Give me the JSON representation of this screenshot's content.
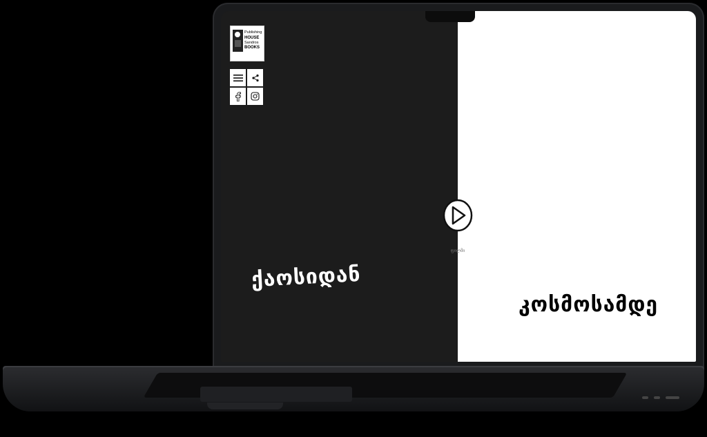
{
  "logo": {
    "line1": "Publishing",
    "line2": "HOUSE",
    "line3": "Sandros",
    "line4": "BOOKS"
  },
  "nav": {
    "menu_icon": "hamburger-icon",
    "share_icon": "share-icon",
    "facebook_icon": "facebook-icon",
    "instagram_icon": "instagram-icon"
  },
  "hero": {
    "title_left": "ქაოსიდან",
    "title_right": "კოსმოსამდე",
    "play_caption": "ფილმი"
  },
  "colors": {
    "left_panel": "#1c1c1c",
    "right_panel": "#ffffff"
  }
}
